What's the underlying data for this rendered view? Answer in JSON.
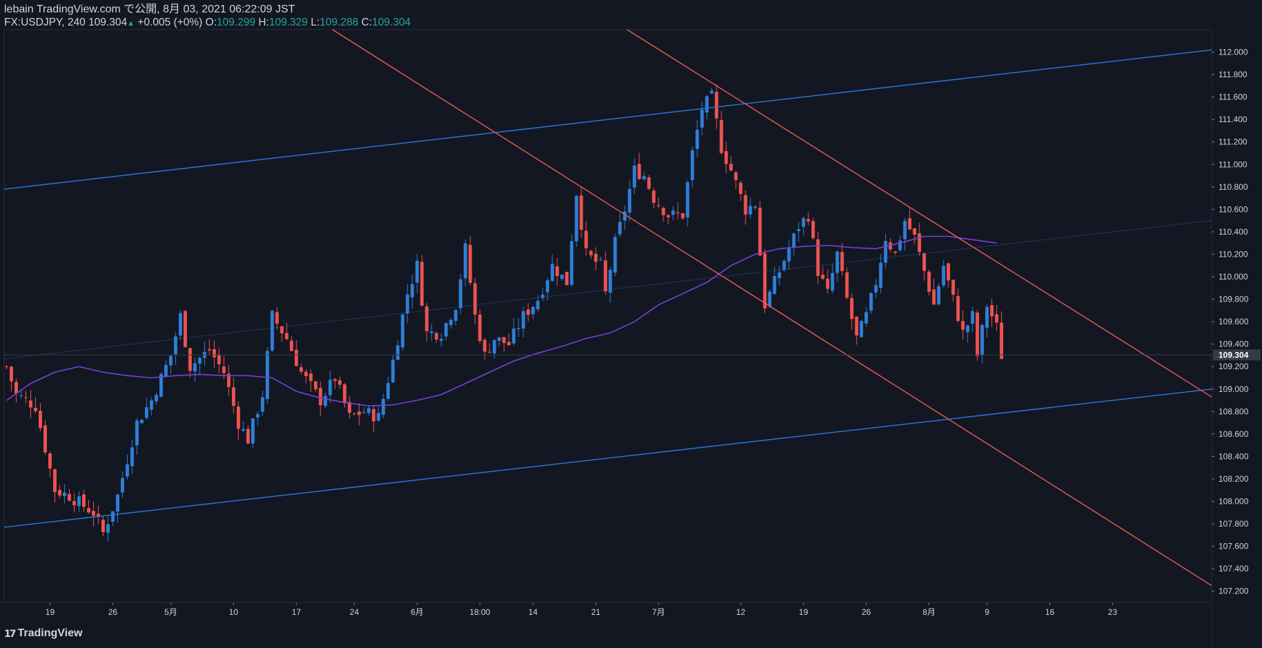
{
  "header": {
    "line1": "lebain TradingView.com で公開, 8月 03, 2021 06:22:09 JST",
    "symbol": "FX:USDJPY, 240",
    "last": "109.304",
    "change_arrow": "▲",
    "change": "+0.005 (+0%)",
    "o_label": "O:",
    "o": "109.299",
    "h_label": "H:",
    "h": "109.329",
    "l_label": "L:",
    "l": "109.288",
    "c_label": "C:",
    "c": "109.304"
  },
  "footer": {
    "brand": "TradingView",
    "logo_icon": "tradingview-logo-icon"
  },
  "colors": {
    "background": "#131722",
    "up_candle": "#2f7fd8",
    "down_candle": "#ef5350",
    "moving_average": "#7b3fd9",
    "channel_blue": "#2a7be0",
    "channel_red": "#f05a5a",
    "price_label_bg": "#363a45"
  },
  "chart_data": {
    "type": "candlestick",
    "symbol": "FX:USDJPY",
    "interval": "240",
    "ylim": [
      107.1,
      112.2
    ],
    "y_ticks": [
      "112.000",
      "111.800",
      "111.600",
      "111.400",
      "111.200",
      "111.000",
      "110.800",
      "110.600",
      "110.400",
      "110.200",
      "110.000",
      "109.800",
      "109.600",
      "109.400",
      "109.200",
      "109.000",
      "108.800",
      "108.600",
      "108.400",
      "108.200",
      "108.000",
      "107.800",
      "107.600",
      "107.400",
      "107.200"
    ],
    "current_price_label": "109.304",
    "x_ticks": [
      "19",
      "26",
      "5月",
      "10",
      "17",
      "24",
      "6月",
      "18:00",
      "14",
      "21",
      "7月",
      "12",
      "19",
      "26",
      "8月",
      "9",
      "16",
      "23"
    ],
    "bar_count": 250,
    "last_bar_index": 226,
    "x_tick_bars": [
      9,
      22,
      34,
      47,
      60,
      72,
      85,
      98,
      109,
      122,
      135,
      152,
      165,
      178,
      191,
      203,
      216,
      229
    ],
    "close_path": [
      {
        "bar": 0,
        "close": 109.2
      },
      {
        "bar": 2,
        "close": 108.95
      },
      {
        "bar": 6,
        "close": 108.85
      },
      {
        "bar": 10,
        "close": 108.1
      },
      {
        "bar": 13,
        "close": 108.05
      },
      {
        "bar": 18,
        "close": 107.9
      },
      {
        "bar": 20,
        "close": 107.72
      },
      {
        "bar": 23,
        "close": 108.05
      },
      {
        "bar": 27,
        "close": 108.7
      },
      {
        "bar": 30,
        "close": 108.9
      },
      {
        "bar": 34,
        "close": 109.3
      },
      {
        "bar": 36,
        "close": 109.65
      },
      {
        "bar": 38,
        "close": 109.2
      },
      {
        "bar": 42,
        "close": 109.35
      },
      {
        "bar": 45,
        "close": 109.15
      },
      {
        "bar": 48,
        "close": 108.7
      },
      {
        "bar": 50,
        "close": 108.55
      },
      {
        "bar": 53,
        "close": 108.95
      },
      {
        "bar": 55,
        "close": 109.65
      },
      {
        "bar": 58,
        "close": 109.45
      },
      {
        "bar": 61,
        "close": 109.15
      },
      {
        "bar": 65,
        "close": 108.9
      },
      {
        "bar": 68,
        "close": 109.1
      },
      {
        "bar": 71,
        "close": 108.75
      },
      {
        "bar": 74,
        "close": 108.8
      },
      {
        "bar": 77,
        "close": 108.75
      },
      {
        "bar": 80,
        "close": 109.25
      },
      {
        "bar": 83,
        "close": 109.85
      },
      {
        "bar": 85,
        "close": 110.1
      },
      {
        "bar": 87,
        "close": 109.5
      },
      {
        "bar": 90,
        "close": 109.5
      },
      {
        "bar": 93,
        "close": 109.75
      },
      {
        "bar": 95,
        "close": 110.25
      },
      {
        "bar": 97,
        "close": 109.65
      },
      {
        "bar": 99,
        "close": 109.3
      },
      {
        "bar": 101,
        "close": 109.45
      },
      {
        "bar": 104,
        "close": 109.4
      },
      {
        "bar": 107,
        "close": 109.65
      },
      {
        "bar": 110,
        "close": 109.8
      },
      {
        "bar": 113,
        "close": 110.1
      },
      {
        "bar": 116,
        "close": 109.95
      },
      {
        "bar": 118,
        "close": 110.75
      },
      {
        "bar": 120,
        "close": 110.2
      },
      {
        "bar": 123,
        "close": 110.1
      },
      {
        "bar": 124,
        "close": 109.85
      },
      {
        "bar": 126,
        "close": 110.3
      },
      {
        "bar": 128,
        "close": 110.6
      },
      {
        "bar": 130,
        "close": 110.95
      },
      {
        "bar": 132,
        "close": 110.9
      },
      {
        "bar": 134,
        "close": 110.7
      },
      {
        "bar": 137,
        "close": 110.55
      },
      {
        "bar": 140,
        "close": 110.55
      },
      {
        "bar": 142,
        "close": 111.1
      },
      {
        "bar": 144,
        "close": 111.5
      },
      {
        "bar": 146,
        "close": 111.6
      },
      {
        "bar": 148,
        "close": 111.15
      },
      {
        "bar": 150,
        "close": 110.95
      },
      {
        "bar": 153,
        "close": 110.6
      },
      {
        "bar": 155,
        "close": 110.65
      },
      {
        "bar": 157,
        "close": 109.75
      },
      {
        "bar": 159,
        "close": 109.95
      },
      {
        "bar": 161,
        "close": 110.15
      },
      {
        "bar": 164,
        "close": 110.45
      },
      {
        "bar": 166,
        "close": 110.55
      },
      {
        "bar": 168,
        "close": 110.05
      },
      {
        "bar": 170,
        "close": 109.85
      },
      {
        "bar": 172,
        "close": 110.2
      },
      {
        "bar": 174,
        "close": 109.8
      },
      {
        "bar": 176,
        "close": 109.45
      },
      {
        "bar": 178,
        "close": 109.65
      },
      {
        "bar": 180,
        "close": 109.95
      },
      {
        "bar": 182,
        "close": 110.35
      },
      {
        "bar": 184,
        "close": 110.2
      },
      {
        "bar": 186,
        "close": 110.5
      },
      {
        "bar": 188,
        "close": 110.35
      },
      {
        "bar": 190,
        "close": 110.05
      },
      {
        "bar": 192,
        "close": 109.75
      },
      {
        "bar": 194,
        "close": 110.1
      },
      {
        "bar": 196,
        "close": 109.8
      },
      {
        "bar": 198,
        "close": 109.5
      },
      {
        "bar": 200,
        "close": 109.65
      },
      {
        "bar": 201,
        "close": 109.3
      },
      {
        "bar": 203,
        "close": 109.75
      },
      {
        "bar": 205,
        "close": 109.55
      },
      {
        "bar": 206,
        "close": 109.3
      }
    ],
    "moving_average": [
      {
        "bar": 0,
        "value": 108.9
      },
      {
        "bar": 5,
        "value": 109.05
      },
      {
        "bar": 10,
        "value": 109.15
      },
      {
        "bar": 15,
        "value": 109.2
      },
      {
        "bar": 20,
        "value": 109.15
      },
      {
        "bar": 25,
        "value": 109.12
      },
      {
        "bar": 30,
        "value": 109.1
      },
      {
        "bar": 35,
        "value": 109.12
      },
      {
        "bar": 40,
        "value": 109.13
      },
      {
        "bar": 45,
        "value": 109.12
      },
      {
        "bar": 50,
        "value": 109.12
      },
      {
        "bar": 55,
        "value": 109.1
      },
      {
        "bar": 60,
        "value": 108.98
      },
      {
        "bar": 65,
        "value": 108.92
      },
      {
        "bar": 70,
        "value": 108.88
      },
      {
        "bar": 75,
        "value": 108.85
      },
      {
        "bar": 80,
        "value": 108.86
      },
      {
        "bar": 85,
        "value": 108.9
      },
      {
        "bar": 90,
        "value": 108.95
      },
      {
        "bar": 95,
        "value": 109.05
      },
      {
        "bar": 100,
        "value": 109.15
      },
      {
        "bar": 105,
        "value": 109.25
      },
      {
        "bar": 110,
        "value": 109.32
      },
      {
        "bar": 115,
        "value": 109.38
      },
      {
        "bar": 120,
        "value": 109.45
      },
      {
        "bar": 125,
        "value": 109.5
      },
      {
        "bar": 130,
        "value": 109.6
      },
      {
        "bar": 135,
        "value": 109.75
      },
      {
        "bar": 140,
        "value": 109.85
      },
      {
        "bar": 145,
        "value": 109.95
      },
      {
        "bar": 150,
        "value": 110.1
      },
      {
        "bar": 155,
        "value": 110.2
      },
      {
        "bar": 160,
        "value": 110.25
      },
      {
        "bar": 165,
        "value": 110.27
      },
      {
        "bar": 170,
        "value": 110.28
      },
      {
        "bar": 175,
        "value": 110.26
      },
      {
        "bar": 180,
        "value": 110.25
      },
      {
        "bar": 185,
        "value": 110.3
      },
      {
        "bar": 190,
        "value": 110.36
      },
      {
        "bar": 195,
        "value": 110.36
      },
      {
        "bar": 200,
        "value": 110.33
      },
      {
        "bar": 205,
        "value": 110.3
      }
    ],
    "trendlines": [
      {
        "name": "upper-blue-channel",
        "style": "solid",
        "color": "#2a7be0",
        "from": {
          "bar": 0,
          "price": 110.78
        },
        "to": {
          "bar": 250,
          "price": 112.02
        }
      },
      {
        "name": "lower-blue-channel",
        "style": "solid",
        "color": "#2a7be0",
        "from": {
          "bar": 0,
          "price": 107.77
        },
        "to": {
          "bar": 250,
          "price": 109.0
        }
      },
      {
        "name": "middle-blue-dotted",
        "style": "dotted",
        "color": "#2a7be0",
        "from": {
          "bar": 0,
          "price": 109.27
        },
        "to": {
          "bar": 250,
          "price": 110.5
        }
      },
      {
        "name": "red-upper-channel",
        "style": "solid",
        "color": "#f05a5a",
        "from": {
          "bar": 129,
          "price": 112.2
        },
        "to": {
          "bar": 250,
          "price": 108.93
        }
      },
      {
        "name": "red-lower-channel",
        "style": "solid",
        "color": "#f05a5a",
        "from": {
          "bar": 68,
          "price": 112.2
        },
        "to": {
          "bar": 250,
          "price": 107.25
        }
      }
    ],
    "grid": false,
    "legend": "none"
  }
}
